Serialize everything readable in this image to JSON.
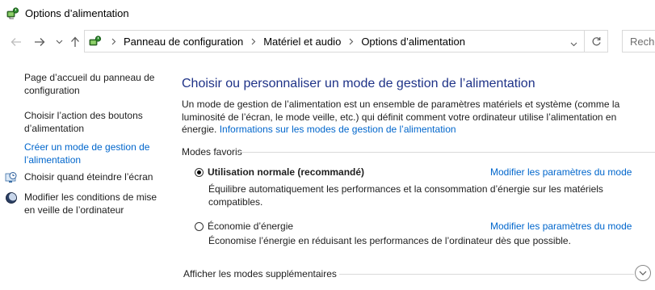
{
  "window": {
    "title": "Options d’alimentation"
  },
  "address_bar": {
    "crumbs": [
      "Panneau de configuration",
      "Matériel et audio",
      "Options d’alimentation"
    ]
  },
  "search": {
    "placeholder": "Rechercher"
  },
  "sidebar": {
    "home_link": "Page d’accueil du panneau de configuration",
    "items": [
      {
        "label": "Choisir l’action des boutons d’alimentation",
        "icon": ""
      },
      {
        "label": "Créer un mode de gestion de l’alimentation",
        "icon": "",
        "active": true
      },
      {
        "label": "Choisir quand éteindre l’écran",
        "icon": "monitor-clock-icon"
      },
      {
        "label": "Modifier les conditions de mise en veille de l’ordinateur",
        "icon": "moon-icon"
      }
    ]
  },
  "main": {
    "title": "Choisir ou personnaliser un mode de gestion de l’alimentation",
    "intro_text": "Un mode de gestion de l’alimentation est un ensemble de paramètres matériels et système (comme la luminosité de l’écran, le mode veille, etc.) qui définit comment votre ordinateur utilise l’alimentation en énergie.",
    "intro_link": "Informations sur les modes de gestion de l’alimentation",
    "favorites_header": "Modes favoris",
    "plans": [
      {
        "name": "Utilisation normale (recommandé)",
        "selected": true,
        "modify_link": "Modifier les paramètres du mode",
        "description": "Équilibre automatiquement les performances et la consommation d’énergie sur les matériels compatibles."
      },
      {
        "name": "Économie d’énergie",
        "selected": false,
        "modify_link": "Modifier les paramètres du mode",
        "description": "Économise l’énergie en réduisant les performances de l’ordinateur dès que possible."
      }
    ],
    "more_plans_label": "Afficher les modes supplémentaires"
  },
  "colors": {
    "link": "#0066cc",
    "title": "#1e3287",
    "text": "#1e1e1e"
  }
}
